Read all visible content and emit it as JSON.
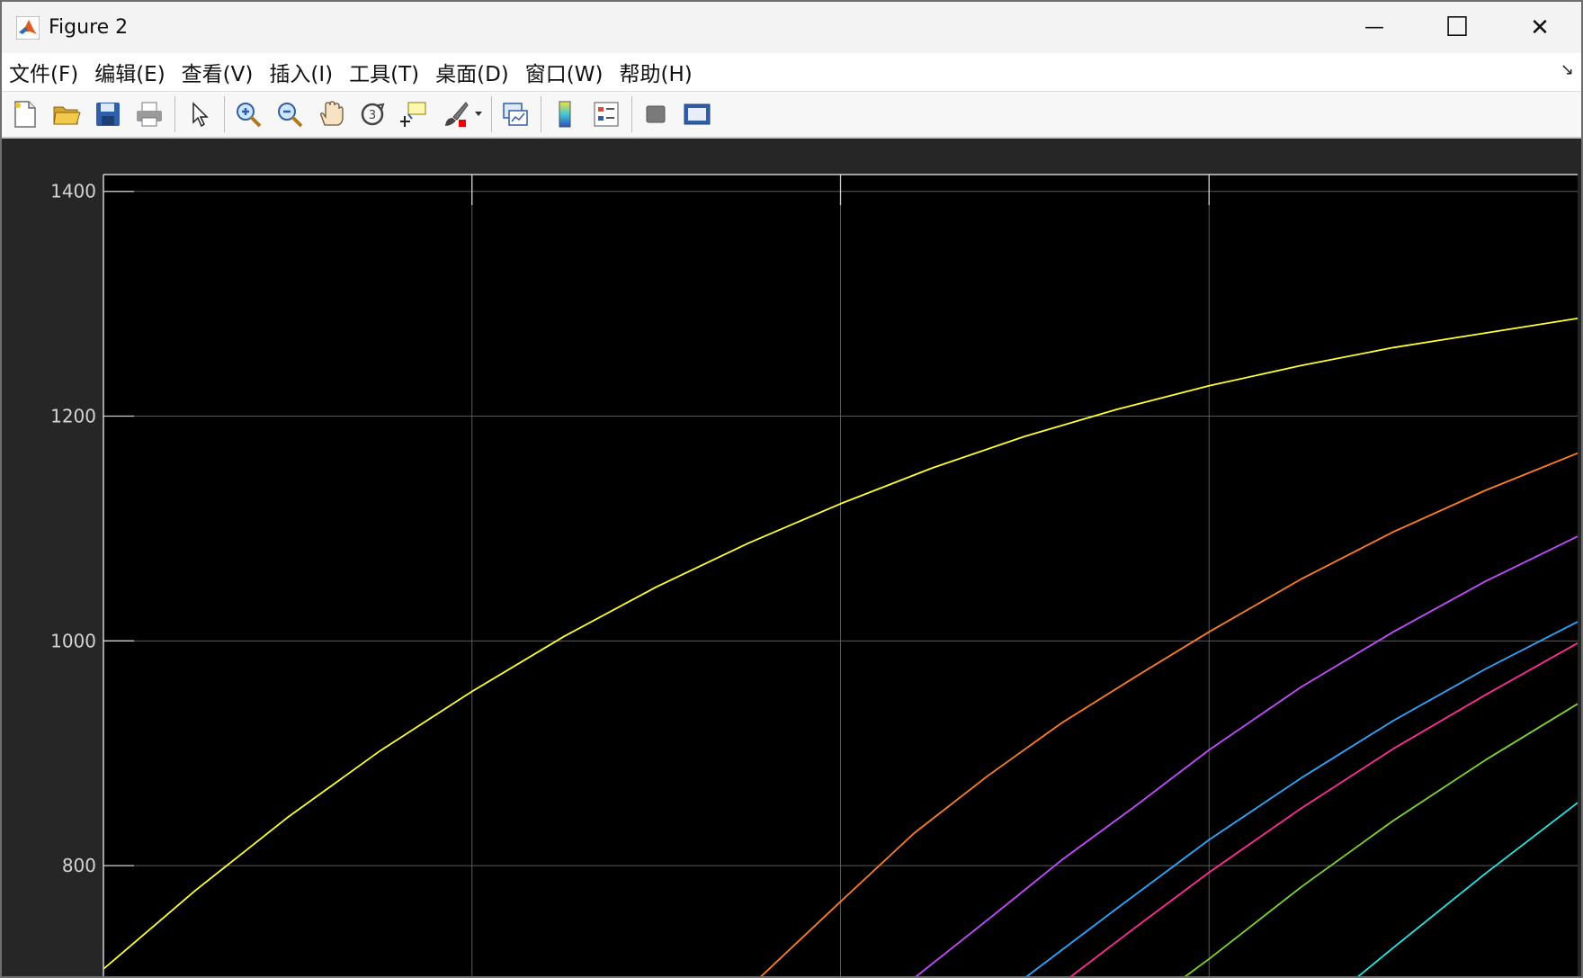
{
  "window": {
    "title": "Figure 2",
    "controls": {
      "minimize": "—",
      "maximize": "☐",
      "close": "✕"
    }
  },
  "menubar": {
    "items": [
      {
        "label": "文件(F)"
      },
      {
        "label": "编辑(E)"
      },
      {
        "label": "查看(V)"
      },
      {
        "label": "插入(I)"
      },
      {
        "label": "工具(T)"
      },
      {
        "label": "桌面(D)"
      },
      {
        "label": "窗口(W)"
      },
      {
        "label": "帮助(H)"
      }
    ]
  },
  "toolbar": {
    "buttons": [
      "new-figure-icon",
      "open-file-icon",
      "save-icon",
      "print-icon",
      "pointer-icon",
      "zoom-in-icon",
      "zoom-out-icon",
      "pan-hand-icon",
      "rotate-3d-icon",
      "data-cursor-icon",
      "brush-icon",
      "link-plot-icon",
      "colorbar-icon",
      "legend-icon",
      "hide-plot-tools-icon",
      "show-plot-tools-icon"
    ]
  },
  "colors": {
    "axes_background": "#000000",
    "figure_background": "#262626",
    "grid": "#5a5a5a",
    "tick_label": "#d4d4d4"
  },
  "chart_data": {
    "type": "line",
    "title": "",
    "xlabel": "",
    "ylabel": "",
    "ylim": [
      700,
      1415
    ],
    "xlim": [
      0,
      4
    ],
    "yticks": [
      800,
      1000,
      1200,
      1400
    ],
    "xticks": [
      1,
      2,
      3
    ],
    "grid": true,
    "series": [
      {
        "color": "#ffff33",
        "x": [
          0,
          0.25,
          0.5,
          0.75,
          1.0,
          1.25,
          1.5,
          1.75,
          2.0,
          2.25,
          2.5,
          2.75,
          3.0,
          3.25,
          3.5,
          3.75,
          4.0
        ],
        "y": [
          708,
          778,
          843,
          902,
          955,
          1004,
          1048,
          1087,
          1122,
          1154,
          1182,
          1206,
          1227,
          1245,
          1261,
          1274,
          1287
        ]
      },
      {
        "color": "#ff7f27",
        "x": [
          1.78,
          2.0,
          2.2,
          2.4,
          2.6,
          2.8,
          3.0,
          3.25,
          3.5,
          3.75,
          4.0
        ],
        "y": [
          700,
          768,
          829,
          880,
          927,
          968,
          1008,
          1055,
          1097,
          1134,
          1167
        ]
      },
      {
        "color": "#c44dff",
        "x": [
          2.2,
          2.4,
          2.6,
          2.8,
          3.0,
          3.25,
          3.5,
          3.75,
          4.0
        ],
        "y": [
          700,
          752,
          805,
          853,
          903,
          959,
          1008,
          1053,
          1093
        ]
      },
      {
        "color": "#2ea8ff",
        "x": [
          2.5,
          2.75,
          3.0,
          3.25,
          3.5,
          3.75,
          4.0
        ],
        "y": [
          700,
          762,
          823,
          878,
          929,
          975,
          1017
        ]
      },
      {
        "color": "#ff2e9b",
        "x": [
          2.62,
          2.8,
          3.0,
          3.25,
          3.5,
          3.75,
          4.0
        ],
        "y": [
          700,
          745,
          794,
          851,
          904,
          952,
          998
        ]
      },
      {
        "color": "#7fd633",
        "x": [
          2.93,
          3.0,
          3.25,
          3.5,
          3.75,
          4.0
        ],
        "y": [
          700,
          717,
          781,
          840,
          894,
          944
        ]
      },
      {
        "color": "#26e6e6",
        "x": [
          3.4,
          3.5,
          3.75,
          4.0
        ],
        "y": [
          700,
          727,
          793,
          856
        ]
      }
    ]
  }
}
